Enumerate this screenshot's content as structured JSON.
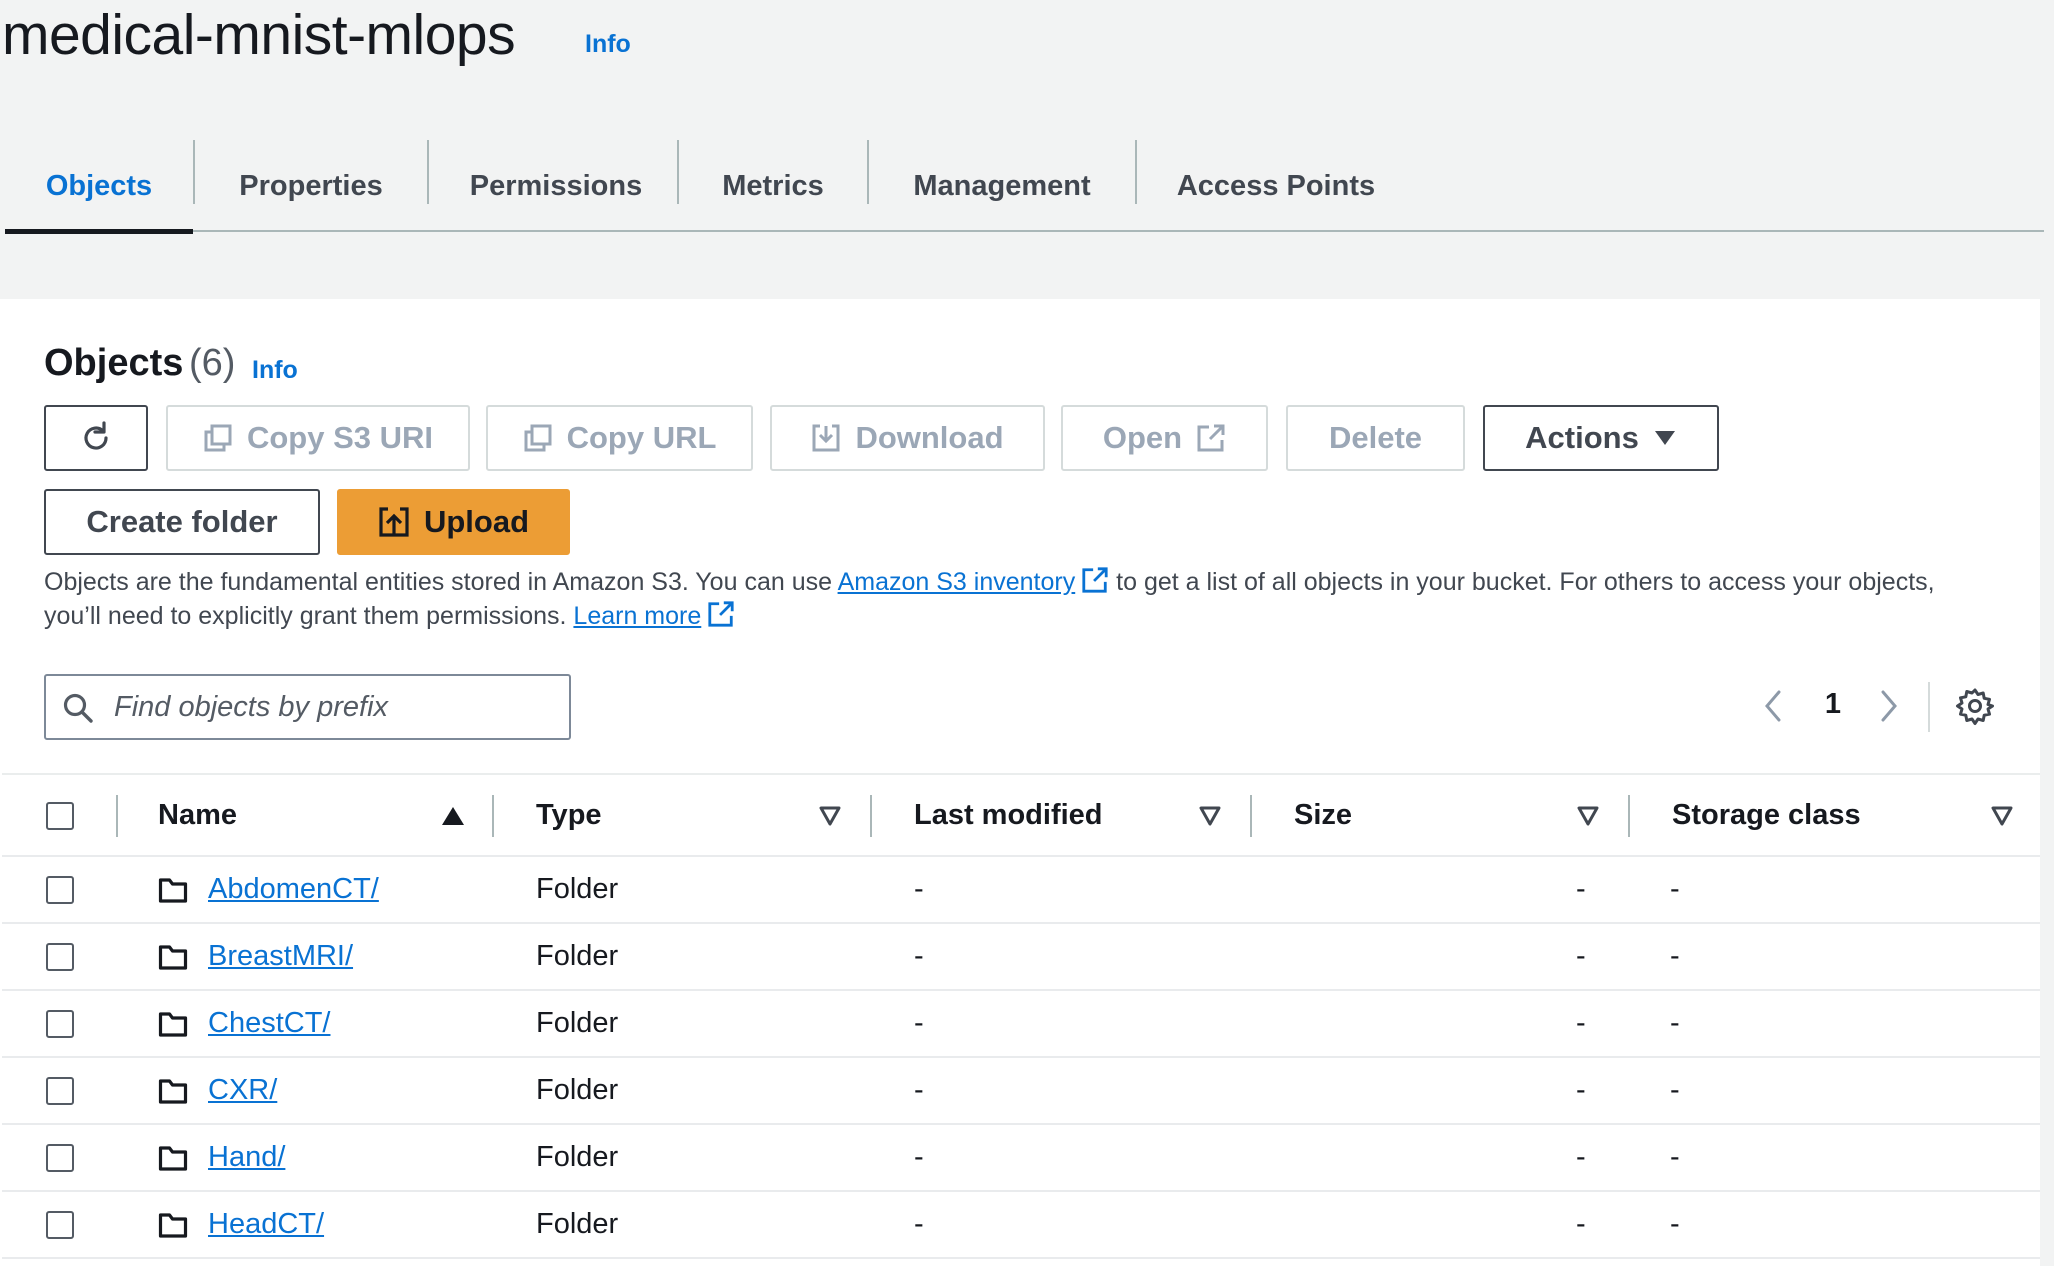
{
  "header": {
    "title": "medical-mnist-mlops",
    "info": "Info"
  },
  "tabs": [
    {
      "label": "Objects",
      "active": true
    },
    {
      "label": "Properties"
    },
    {
      "label": "Permissions"
    },
    {
      "label": "Metrics"
    },
    {
      "label": "Management"
    },
    {
      "label": "Access Points"
    }
  ],
  "objects": {
    "heading": "Objects",
    "count": "(6)",
    "info": "Info"
  },
  "toolbar": {
    "refresh_icon": "refresh-icon",
    "copy_s3_uri": "Copy S3 URI",
    "copy_url": "Copy URL",
    "download": "Download",
    "open": "Open",
    "delete": "Delete",
    "actions": "Actions",
    "create_folder": "Create folder",
    "upload": "Upload"
  },
  "description": {
    "text_1": "Objects are the fundamental entities stored in Amazon S3. You can use ",
    "link_inventory": "Amazon S3 inventory",
    "text_2": " to get a list of all objects in your bucket. For others to access your objects,",
    "text_3": "you’ll need to explicitly grant them permissions. ",
    "link_learn_more": "Learn more"
  },
  "search": {
    "placeholder": "Find objects by prefix",
    "value": ""
  },
  "pagination": {
    "page": "1"
  },
  "table": {
    "columns": [
      "Name",
      "Type",
      "Last modified",
      "Size",
      "Storage class"
    ],
    "rows": [
      {
        "name": "AbdomenCT/",
        "type": "Folder",
        "last_modified": "-",
        "size": "-",
        "storage_class": "-"
      },
      {
        "name": "BreastMRI/",
        "type": "Folder",
        "last_modified": "-",
        "size": "-",
        "storage_class": "-"
      },
      {
        "name": "ChestCT/",
        "type": "Folder",
        "last_modified": "-",
        "size": "-",
        "storage_class": "-"
      },
      {
        "name": "CXR/",
        "type": "Folder",
        "last_modified": "-",
        "size": "-",
        "storage_class": "-"
      },
      {
        "name": "Hand/",
        "type": "Folder",
        "last_modified": "-",
        "size": "-",
        "storage_class": "-"
      },
      {
        "name": "HeadCT/",
        "type": "Folder",
        "last_modified": "-",
        "size": "-",
        "storage_class": "-"
      }
    ]
  },
  "colors": {
    "link": "#0972d3",
    "primary_button": "#ec9d35",
    "text": "#16191f",
    "disabled": "#9ba7b6"
  }
}
